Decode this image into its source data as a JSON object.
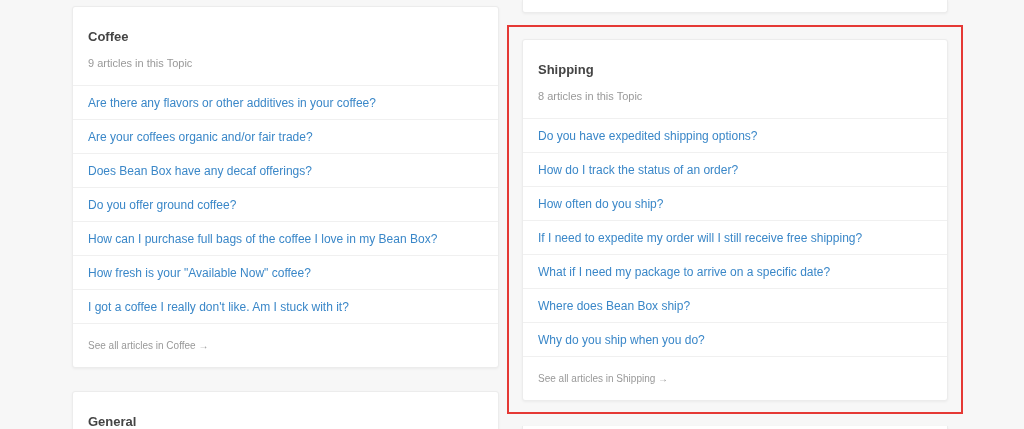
{
  "columns": [
    {
      "cards": [
        {
          "kind": "topic",
          "highlighted": false,
          "title": "Coffee",
          "subtitle": "9 articles in this Topic",
          "articles": [
            "Are there any flavors or other additives in your coffee?",
            "Are your coffees organic and/or fair trade?",
            "Does Bean Box have any decaf offerings?",
            "Do you offer ground coffee?",
            "How can I purchase full bags of the coffee I love in my Bean Box?",
            "How fresh is your \"Available Now\" coffee?",
            "I got a coffee I really don't like. Am I stuck with it?"
          ],
          "footer": "See all articles in Coffee →"
        },
        {
          "kind": "topic",
          "highlighted": false,
          "title": "General"
        }
      ]
    },
    {
      "cards": [
        {
          "kind": "edge",
          "highlighted": false
        },
        {
          "kind": "topic",
          "highlighted": true,
          "title": "Shipping",
          "subtitle": "8 articles in this Topic",
          "articles": [
            "Do you have expedited shipping options?",
            "How do I track the status of an order?",
            "How often do you ship?",
            "If I need to expedite my order will I still receive free shipping?",
            "What if I need my package to arrive on a specific date?",
            "Where does Bean Box ship?",
            "Why do you ship when you do?"
          ],
          "footer": "See all articles in Shipping →"
        },
        {
          "kind": "edge",
          "highlighted": false
        }
      ]
    }
  ]
}
